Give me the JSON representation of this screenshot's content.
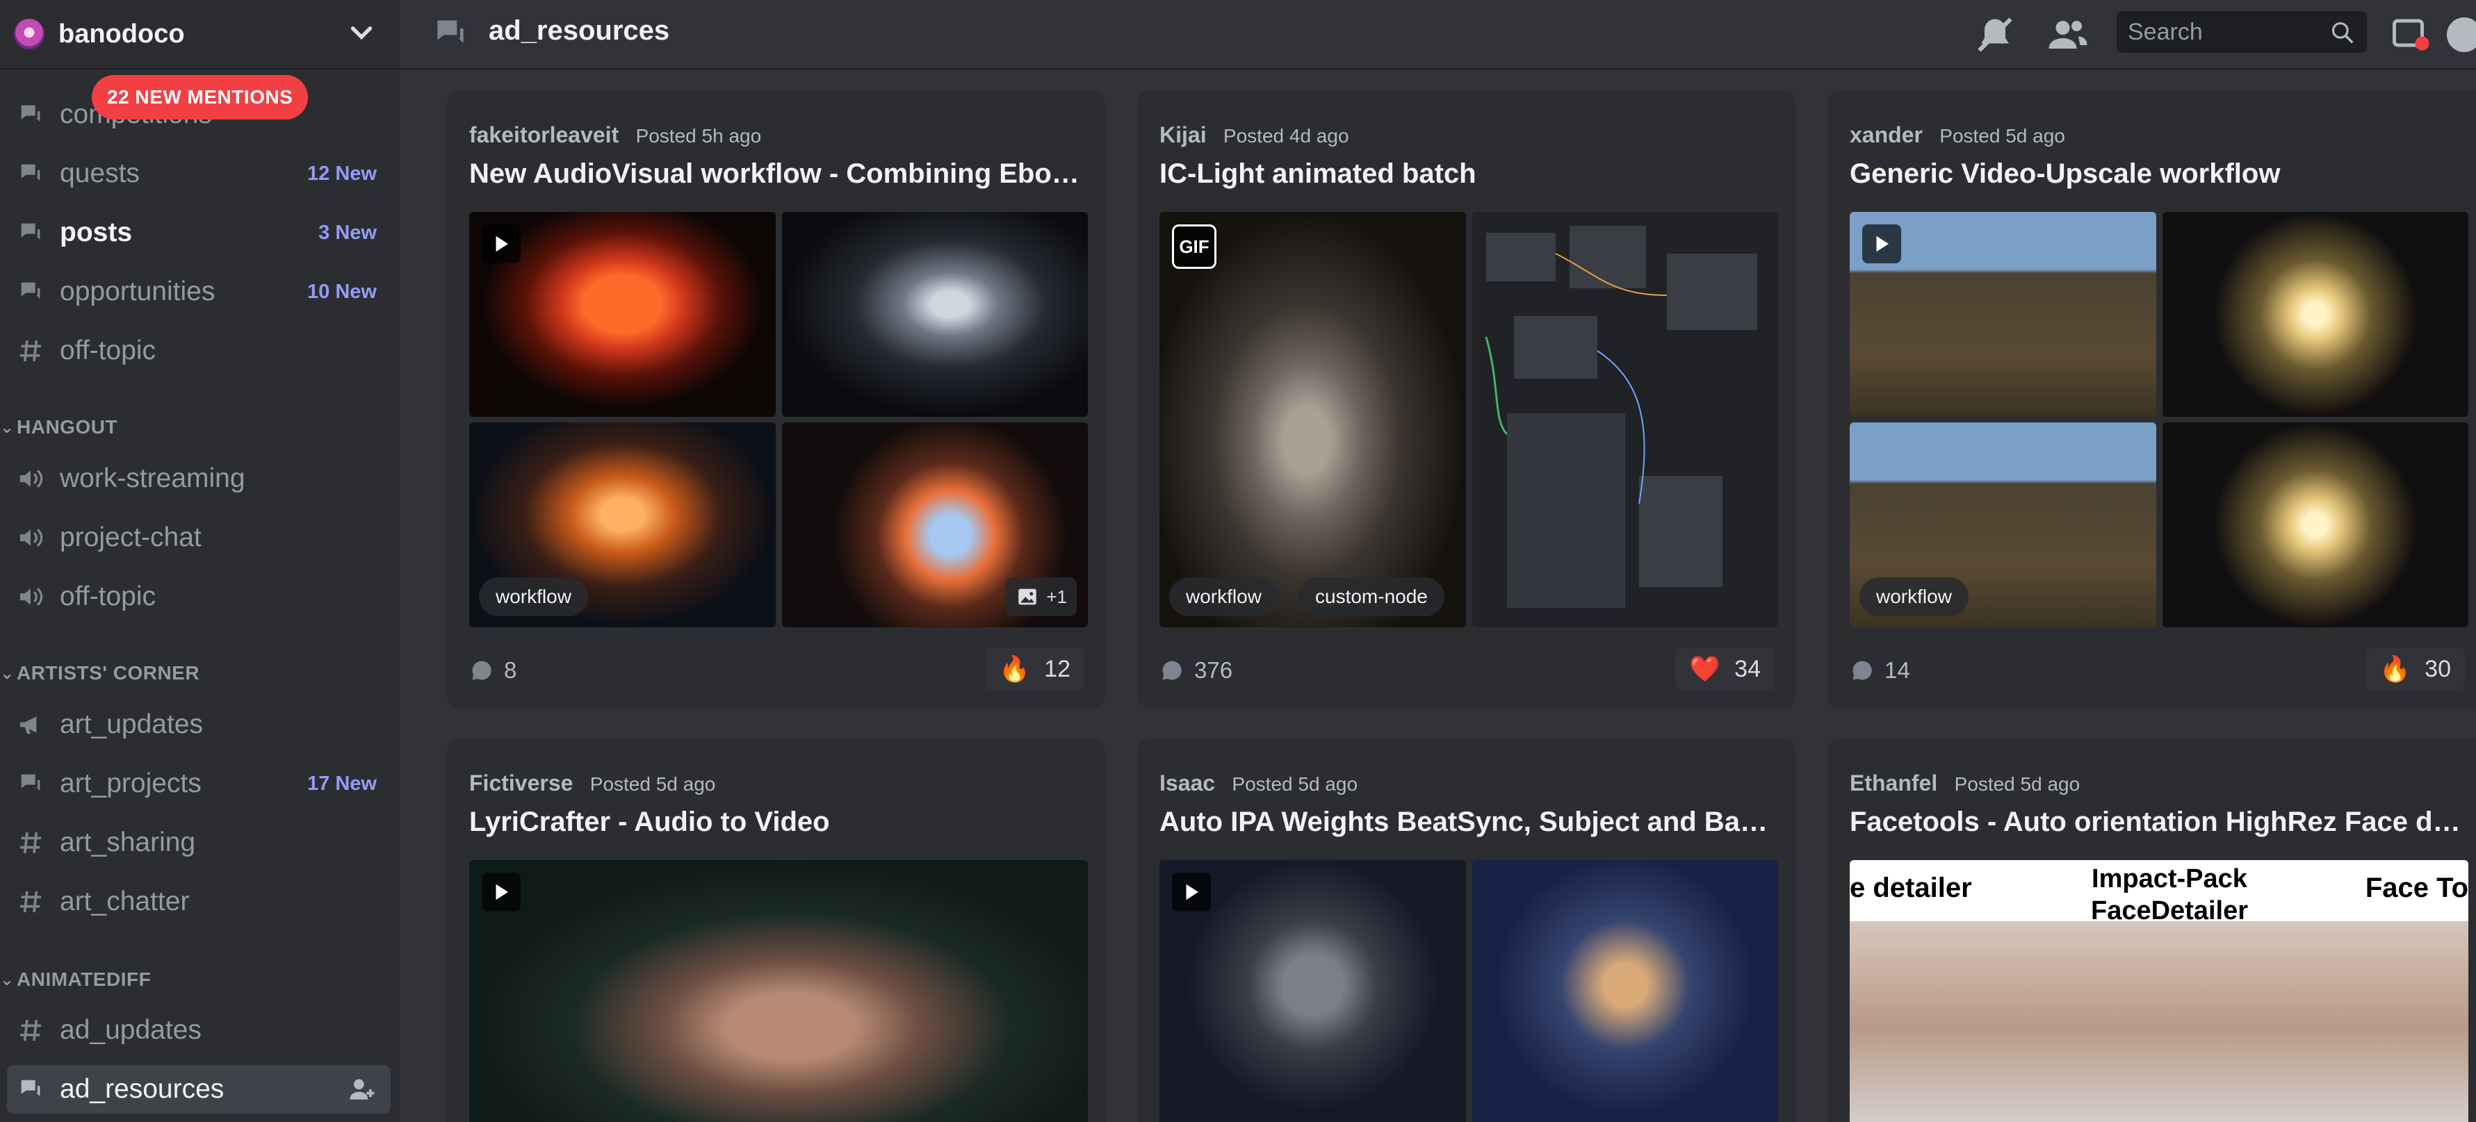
{
  "server": {
    "name": "banodoco"
  },
  "mentions": {
    "label": "22 NEW MENTIONS"
  },
  "sidebar": {
    "channels_top": [
      {
        "name": "competitions",
        "type": "forum",
        "badge": ""
      },
      {
        "name": "quests",
        "type": "forum",
        "badge": "12 New"
      },
      {
        "name": "posts",
        "type": "forum",
        "badge": "3 New"
      },
      {
        "name": "opportunities",
        "type": "forum",
        "badge": "10 New"
      },
      {
        "name": "off-topic",
        "type": "text",
        "badge": ""
      }
    ],
    "categories": [
      {
        "name": "HANGOUT"
      },
      {
        "name": "ARTISTS' CORNER"
      },
      {
        "name": "ANIMATEDIFF"
      }
    ],
    "hangout": [
      {
        "name": "work-streaming",
        "type": "voice"
      },
      {
        "name": "project-chat",
        "type": "voice"
      },
      {
        "name": "off-topic",
        "type": "voice"
      }
    ],
    "artists": [
      {
        "name": "art_updates",
        "type": "announcement",
        "badge": ""
      },
      {
        "name": "art_projects",
        "type": "forum",
        "badge": "17 New"
      },
      {
        "name": "art_sharing",
        "type": "text",
        "badge": ""
      },
      {
        "name": "art_chatter",
        "type": "text",
        "badge": ""
      }
    ],
    "animatediff": [
      {
        "name": "ad_updates",
        "type": "text"
      },
      {
        "name": "ad_resources",
        "type": "forum",
        "active": true
      }
    ]
  },
  "topbar": {
    "title": "ad_resources",
    "search_placeholder": "Search"
  },
  "posts": [
    {
      "author": "fakeitorleaveit",
      "posted": "Posted 5h ago",
      "title": "New AudioVisual workflow - Combining EboSuite with AnimateDiff",
      "tags": [
        "workflow"
      ],
      "more": "+1",
      "comments": "8",
      "reaction_emoji": "🔥",
      "reaction_count": "12"
    },
    {
      "author": "Kijai",
      "posted": "Posted 4d ago",
      "title": "IC-Light animated batch",
      "tags": [
        "workflow",
        "custom-node"
      ],
      "gif": "GIF",
      "comments": "376",
      "reaction_emoji": "❤️",
      "reaction_count": "34"
    },
    {
      "author": "xander",
      "posted": "Posted 5d ago",
      "title": "Generic Video-Upscale workflow",
      "tags": [
        "workflow"
      ],
      "comments": "14",
      "reaction_emoji": "🔥",
      "reaction_count": "30"
    },
    {
      "author": "Fictiverse",
      "posted": "Posted 5d ago",
      "title": "LyriCrafter - Audio to Video"
    },
    {
      "author": "Isaac",
      "posted": "Posted 5d ago",
      "title": "Auto IPA Weights BeatSync, Subject and Background Masks"
    },
    {
      "author": "Ethanfel",
      "posted": "Posted 5d ago",
      "title": "Facetools - Auto orientation HighRez Face detailer",
      "image_text": [
        "e detailer",
        "Impact-Pack FaceDetailer",
        "Face To"
      ]
    }
  ],
  "colors": {
    "accent": "#949cf7",
    "mention": "#f23f43",
    "bg": "#313338",
    "sidebar": "#2b2d31"
  }
}
